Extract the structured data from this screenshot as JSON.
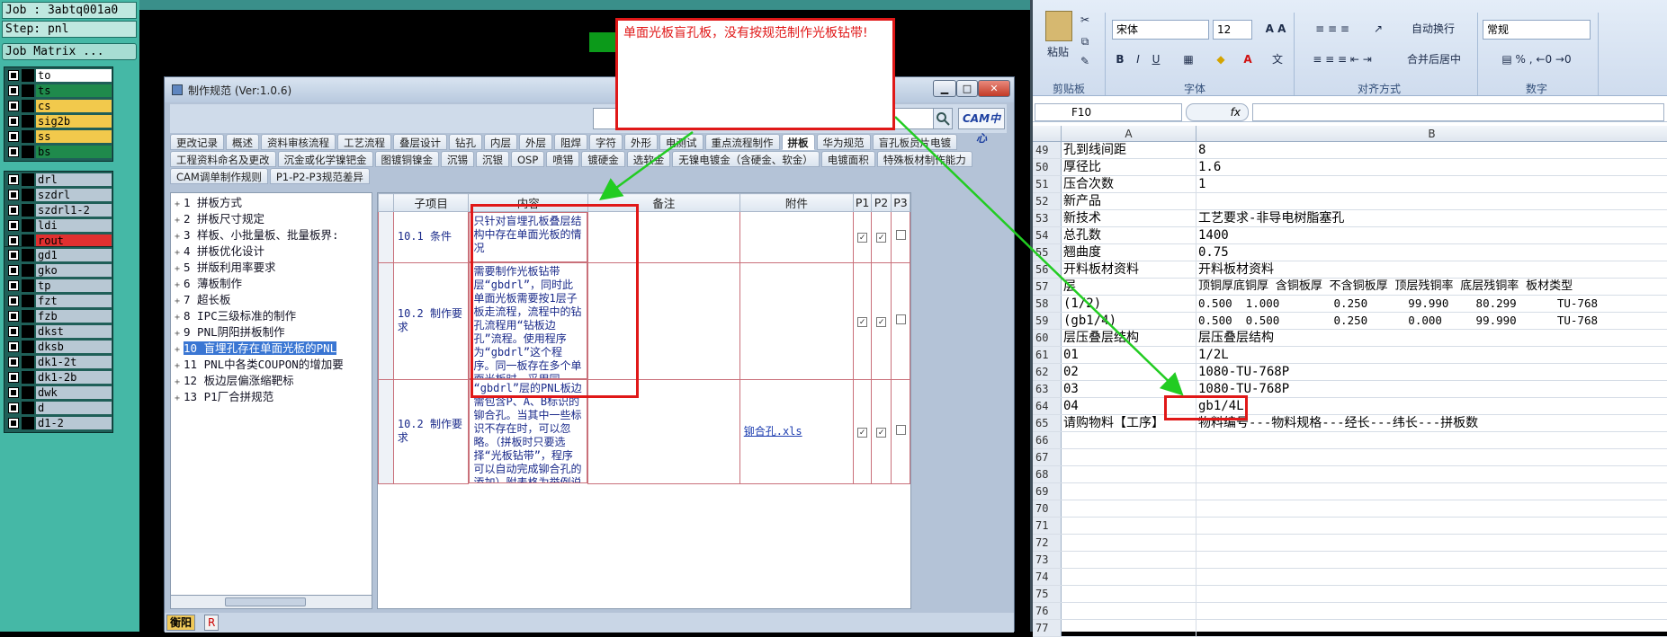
{
  "left_panel": {
    "job": "Job : 3abtq001a0",
    "step": "Step: pnl",
    "matrix_btn": "Job Matrix ...",
    "layers_a": [
      {
        "name": "to",
        "color": "#ffffff"
      },
      {
        "name": "ts",
        "color": "#1f8a4c"
      },
      {
        "name": "cs",
        "color": "#f2c94c"
      },
      {
        "name": "sig2b",
        "color": "#f2c94c"
      },
      {
        "name": "ss",
        "color": "#f2c94c"
      },
      {
        "name": "bs",
        "color": "#1f8a4c"
      }
    ],
    "layers_b": [
      {
        "name": "drl",
        "color": "#b8c8d4"
      },
      {
        "name": "szdrl",
        "color": "#b8c8d4"
      },
      {
        "name": "szdrl1-2",
        "color": "#b8c8d4"
      },
      {
        "name": "ldi",
        "color": "#b8c8d4"
      },
      {
        "name": "rout",
        "color": "#e03030"
      }
    ],
    "layers_c": [
      {
        "name": "gd1",
        "color": "#b8c8d4"
      },
      {
        "name": "gko",
        "color": "#b8c8d4"
      },
      {
        "name": "tp",
        "color": "#b8c8d4"
      },
      {
        "name": "fzt",
        "color": "#b8c8d4"
      },
      {
        "name": "fzb",
        "color": "#b8c8d4"
      },
      {
        "name": "dkst",
        "color": "#b8c8d4"
      },
      {
        "name": "dksb",
        "color": "#b8c8d4"
      },
      {
        "name": "dk1-2t",
        "color": "#b8c8d4"
      },
      {
        "name": "dk1-2b",
        "color": "#b8c8d4"
      },
      {
        "name": "dwk",
        "color": "#b8c8d4"
      },
      {
        "name": "d",
        "color": "#b8c8d4"
      },
      {
        "name": "d1-2",
        "color": "#b8c8d4"
      }
    ]
  },
  "callout": {
    "text": "单面光板盲孔板，没有按规范制作光板钻带!"
  },
  "dialog": {
    "title": "制作规范 (Ver:1.0.6)",
    "logo": "CAM中心",
    "tabs_row1": [
      "更改记录",
      "概述",
      "资料审核流程",
      "工艺流程",
      "叠层设计",
      "钻孔",
      "内层",
      "外层",
      "阻焊",
      "字符",
      "外形",
      "电测试",
      "重点流程制作",
      "拼板",
      "华为规范",
      "盲孔板员片电镀"
    ],
    "tabs_row2": [
      "工程资料命名及更改",
      "沉金或化学镍钯金",
      "图镀铜镍金",
      "沉锡",
      "沉银",
      "OSP",
      "喷锡",
      "镀硬金",
      "选软金",
      "无镍电镀金（含硬金、软金）",
      "电镀面积",
      "特殊板材制作能力"
    ],
    "tabs_row3": [
      "CAM调单制作规则",
      "P1-P2-P3规范差异"
    ],
    "active_tab": "拼板",
    "tree": [
      "1 拼板方式",
      "2 拼板尺寸规定",
      "3 样板、小批量板、批量板界:",
      "4 拼板优化设计",
      "5 拼版利用率要求",
      "6 薄板制作",
      "7 超长板",
      "8 IPC三级标准的制作",
      "9 PNL阴阳拼板制作",
      "10 盲埋孔存在单面光板的PNL",
      "11 PNL中各类COUPON的增加要",
      "12 板边层偏涨缩靶标",
      "13 P1厂合拼规范"
    ],
    "selected_tree": 9,
    "headers": [
      "子项目",
      "内容",
      "备注",
      "附件",
      "P1",
      "P2",
      "P3"
    ],
    "rows": [
      {
        "sub": "10.1 条件",
        "content": "只针对盲埋孔板叠层结构中存在单面光板的情况",
        "note": "",
        "attach": "",
        "p1": "✓",
        "p2": "✓",
        "p3": ""
      },
      {
        "sub": "10.2 制作要求",
        "content": "需要制作光板钻带层“gbdrl”，同时此单面光板需要按1层子板走流程，流程中的钻孔流程用“钻板边孔”流程。使用程序为“gbdrl”这个程序。同一板存在多个单面光板时，采用同一“gbdrl”程序即可",
        "note": "",
        "attach": "",
        "p1": "✓",
        "p2": "✓",
        "p3": ""
      },
      {
        "sub": "10.2 制作要求",
        "content": "“gbdrl”层的PNL板边需包含P、A、B标识的铆合孔。当其中一些标识不存在时，可以忽略。（拼板时只要选择“光板钻带”，程序可以自动完成铆合孔的添加）附表格为举例说明：",
        "note": "",
        "attach": "铆合孔.xls",
        "p1": "✓",
        "p2": "✓",
        "p3": ""
      }
    ],
    "bottom_btns": [
      "衡阳",
      "R"
    ]
  },
  "excel": {
    "font_name": "宋体",
    "font_size": "12",
    "number_format": "常规",
    "wrap_label": "自动换行",
    "merge_label": "合并后居中",
    "paste_label": "粘贴",
    "groups": [
      "剪贴板",
      "字体",
      "对齐方式",
      "数字"
    ],
    "name_box": "F10",
    "fx": "fx",
    "cols": [
      "A",
      "B"
    ],
    "rows": [
      {
        "n": "49",
        "a": "孔到线间距",
        "b": "8"
      },
      {
        "n": "50",
        "a": "厚径比",
        "b": "1.6"
      },
      {
        "n": "51",
        "a": "压合次数",
        "b": "1"
      },
      {
        "n": "52",
        "a": "新产品",
        "b": ""
      },
      {
        "n": "53",
        "a": "新技术",
        "b": "工艺要求-非导电树脂塞孔"
      },
      {
        "n": "54",
        "a": "总孔数",
        "b": "1400"
      },
      {
        "n": "55",
        "a": "翘曲度",
        "b": "0.75"
      },
      {
        "n": "56",
        "a": "开料板材资料",
        "b": "开料板材资料"
      },
      {
        "n": "57",
        "a": "层",
        "b": "顶铜厚底铜厚 含铜板厚 不含铜板厚 顶层残铜率 底层残铜率 板材类型"
      },
      {
        "n": "58",
        "a": "(1/2)",
        "b": "0.500  1.000        0.250      99.990    80.299      TU-768"
      },
      {
        "n": "59",
        "a": "(gb1/4)",
        "b": "0.500  0.500        0.250      0.000     99.990      TU-768"
      },
      {
        "n": "60",
        "a": "层压叠层结构",
        "b": "层压叠层结构"
      },
      {
        "n": "61",
        "a": "01",
        "b": "1/2L"
      },
      {
        "n": "62",
        "a": "02",
        "b": "1080-TU-768P"
      },
      {
        "n": "63",
        "a": "03",
        "b": "1080-TU-768P"
      },
      {
        "n": "64",
        "a": "04",
        "b": "gb1/4L"
      },
      {
        "n": "65",
        "a": "请购物料【工序】",
        "b": "物料编号---物料规格---经长---纬长---拼板数"
      },
      {
        "n": "66",
        "a": "",
        "b": ""
      },
      {
        "n": "67",
        "a": "",
        "b": ""
      },
      {
        "n": "68",
        "a": "",
        "b": ""
      },
      {
        "n": "69",
        "a": "",
        "b": ""
      },
      {
        "n": "70",
        "a": "",
        "b": ""
      },
      {
        "n": "71",
        "a": "",
        "b": ""
      },
      {
        "n": "72",
        "a": "",
        "b": ""
      },
      {
        "n": "73",
        "a": "",
        "b": ""
      },
      {
        "n": "74",
        "a": "",
        "b": ""
      },
      {
        "n": "75",
        "a": "",
        "b": ""
      },
      {
        "n": "76",
        "a": "",
        "b": ""
      },
      {
        "n": "77",
        "a": "",
        "b": ""
      }
    ]
  }
}
